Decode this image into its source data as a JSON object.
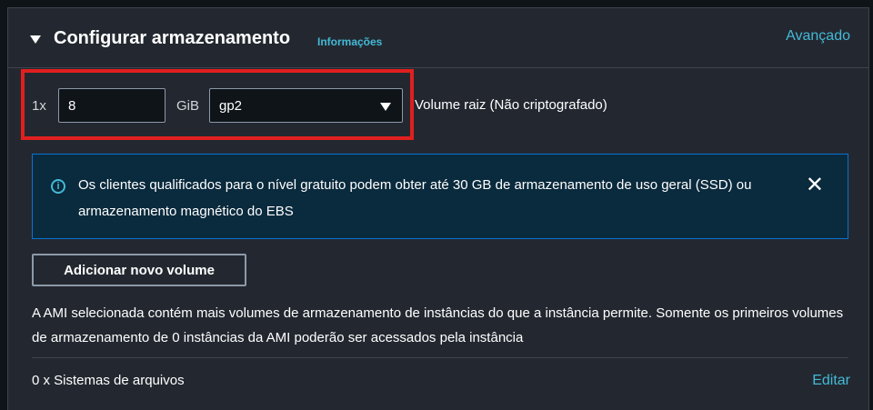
{
  "header": {
    "title": "Configurar armazenamento",
    "info_link": "Informações",
    "advanced_link": "Avançado"
  },
  "volume_row": {
    "multiplier": "1x",
    "size_value": "8",
    "unit": "GiB",
    "volume_type": "gp2",
    "volume_label": "Volume raiz  (Não criptografado)"
  },
  "alert": {
    "text": "Os clientes qualificados para o nível gratuito podem obter até 30 GB de armazenamento de uso geral (SSD) ou armazenamento magnético do EBS",
    "close_glyph": "✕"
  },
  "add_volume_button": "Adicionar novo volume",
  "ami_note": "A AMI selecionada contém mais volumes de armazenamento de instâncias do que a instância permite. Somente os primeiros volumes de armazenamento de 0 instâncias da AMI poderão ser acessados pela instância",
  "file_systems": {
    "label": "0 x Sistemas de arquivos",
    "edit_link": "Editar"
  },
  "colors": {
    "accent_link": "#44b9d6",
    "highlight_box": "#e01f1f",
    "panel_bg": "#232830",
    "alert_border": "#0972d3"
  },
  "icons": {
    "caret": "caret-down-icon",
    "info": "info-circle-icon",
    "close": "close-icon",
    "select": "chevron-down-icon"
  }
}
